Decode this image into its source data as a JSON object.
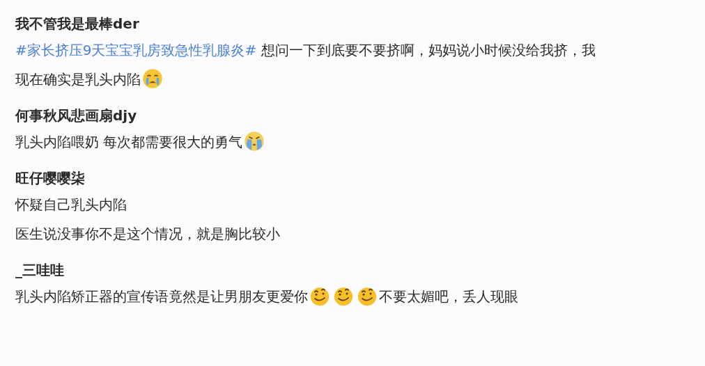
{
  "comments": [
    {
      "user": "我不管我是最棒der",
      "lines": [
        [
          {
            "kind": "hashtag",
            "text": "#家长挤压9天宝宝乳房致急性乳腺炎#"
          },
          {
            "kind": "text",
            "text": " 想问一下到底要不要挤啊，妈妈说小时候没给我挤，我"
          }
        ],
        [
          {
            "kind": "text",
            "text": "现在确实是乳头内陷"
          },
          {
            "kind": "crying-emoji"
          }
        ]
      ]
    },
    {
      "user": "何事秋风悲画扇djy",
      "lines": [
        [
          {
            "kind": "text",
            "text": "乳头内陷喂奶 每次都需要很大的勇气"
          },
          {
            "kind": "sobbing-emoji"
          }
        ]
      ]
    },
    {
      "user": "旺仔嘤嘤柒",
      "lines": [
        [
          {
            "kind": "text",
            "text": "怀疑自己乳头内陷"
          }
        ],
        [
          {
            "kind": "text",
            "text": "医生说没事你不是这个情况，就是胸比较小"
          }
        ]
      ]
    },
    {
      "user": "_三哇哇",
      "lines": [
        [
          {
            "kind": "text",
            "text": "乳头内陷矫正器的宣传语竟然是让男朋友更爱你"
          },
          {
            "kind": "smirking-emoji"
          },
          {
            "kind": "smirking-emoji"
          },
          {
            "kind": "smirking-emoji"
          },
          {
            "kind": "text",
            "text": "不要太媚吧，丢人现眼"
          }
        ]
      ]
    }
  ]
}
